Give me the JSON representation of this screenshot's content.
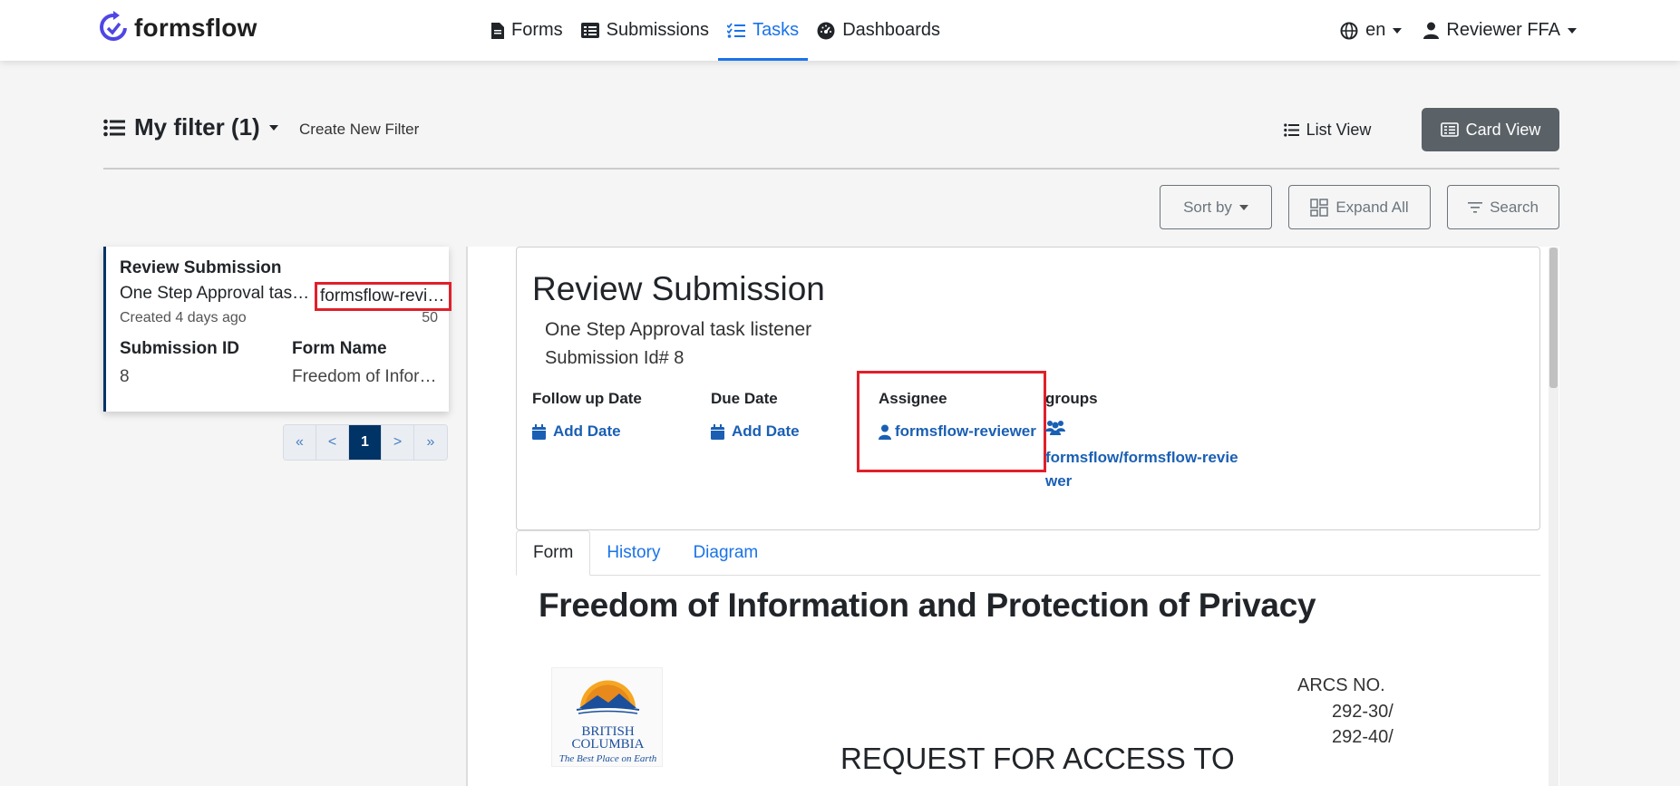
{
  "header": {
    "brand": "formsflow",
    "nav": [
      {
        "label": "Forms",
        "icon": "file-icon"
      },
      {
        "label": "Submissions",
        "icon": "list-icon"
      },
      {
        "label": "Tasks",
        "icon": "tasks-icon",
        "active": true
      },
      {
        "label": "Dashboards",
        "icon": "dashboard-icon"
      }
    ],
    "language": "en",
    "user": "Reviewer FFA"
  },
  "filterbar": {
    "title": "My filter (1)",
    "create_filter": "Create New Filter",
    "list_view": "List View",
    "card_view": "Card View"
  },
  "toolbar": {
    "sort_by": "Sort by",
    "expand_all": "Expand All",
    "search": "Search"
  },
  "task_card": {
    "title": "Review Submission",
    "subtitle": "One Step Approval task listener",
    "assignee": "formsflow-reviewer",
    "created": "Created 4 days ago",
    "priority": "50",
    "submission_id_label": "Submission ID",
    "submission_id": "8",
    "form_name_label": "Form Name",
    "form_name": "Freedom of Information and Protection of Privacy"
  },
  "pagination": {
    "first": "«",
    "prev": "<",
    "current": "1",
    "next": ">",
    "last": "»"
  },
  "detail": {
    "title": "Review Submission",
    "subtitle": "One Step Approval task listener",
    "submission_id": "Submission Id# 8",
    "follow_up_label": "Follow up Date",
    "follow_up_value": "Add Date",
    "due_label": "Due Date",
    "due_value": "Add Date",
    "assignee_label": "Assignee",
    "assignee_value": "formsflow-reviewer",
    "groups_label": "groups",
    "groups_value": "formsflow/formsflow-reviewer"
  },
  "tabs": [
    "Form",
    "History",
    "Diagram"
  ],
  "form": {
    "heading": "Freedom of Information and Protection of Privacy",
    "logo_line1": "BRITISH",
    "logo_line2": "COLUMBIA",
    "logo_tagline": "The Best Place on Earth",
    "arcs_label": "ARCS NO.",
    "arcs_1": "292-30/",
    "arcs_2": "292-40/",
    "request_title": "REQUEST FOR ACCESS TO"
  },
  "colors": {
    "accent": "#1a73e8",
    "highlight": "#e0202a",
    "card_border": "#003366",
    "card_view_bg": "#5a6268"
  }
}
